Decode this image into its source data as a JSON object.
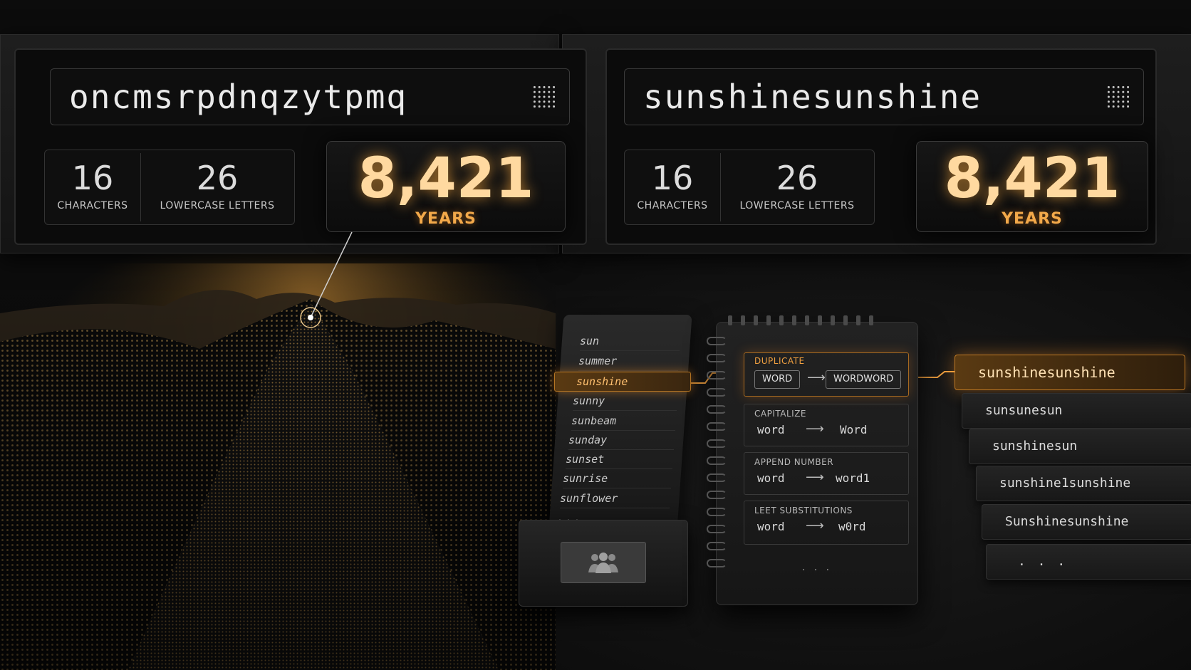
{
  "left_panel": {
    "password": "oncmsrpdnqzytpmq",
    "characters_value": "16",
    "characters_label": "CHARACTERS",
    "letters_value": "26",
    "letters_label": "LOWERCASE LETTERS",
    "years_value": "8,421",
    "years_label": "YEARS"
  },
  "right_panel": {
    "password": "sunshinesunshine",
    "characters_value": "16",
    "characters_label": "CHARACTERS",
    "letters_value": "26",
    "letters_label": "LOWERCASE LETTERS",
    "years_value": "8,421",
    "years_label": "YEARS"
  },
  "dictionary": {
    "words": [
      "sun",
      "summer",
      "sunshine",
      "sunny",
      "sunbeam",
      "sunday",
      "sunset",
      "sunrise",
      "sunflower"
    ],
    "more": "...",
    "highlighted_index": 2
  },
  "rules": [
    {
      "title": "DUPLICATE",
      "from": "WORD",
      "to": "WORDWORD",
      "highlighted": true
    },
    {
      "title": "CAPITALIZE",
      "from": "word",
      "to": "Word",
      "highlighted": false
    },
    {
      "title": "APPEND NUMBER",
      "from": "word",
      "to": "word1",
      "highlighted": false
    },
    {
      "title": "LEET SUBSTITUTIONS",
      "from": "word",
      "to": "w0rd",
      "highlighted": false
    }
  ],
  "rules_more": ". . .",
  "candidates": [
    "sunshinesunshine",
    "sunsunesun",
    "sunshinesun",
    "sunshine1sunshine",
    "Sunshinesunshine"
  ],
  "candidates_more": ". . .",
  "accent_color": "#f3a94a",
  "icons": [
    "grid-dots-icon",
    "people-icon",
    "arrow-right-icon"
  ]
}
